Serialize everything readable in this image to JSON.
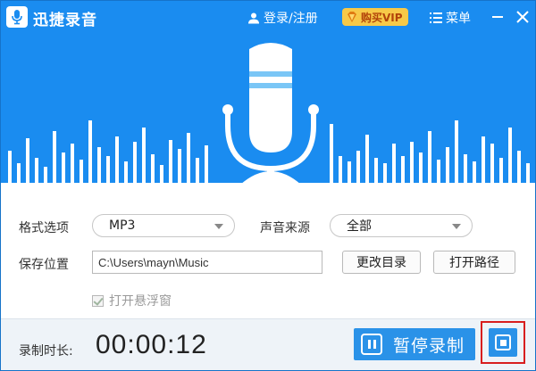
{
  "window": {
    "title": "迅捷录音",
    "login_label": "登录/注册",
    "vip_label": "购买VIP",
    "menu_label": "菜单",
    "icons": {
      "logo": "microphone-logo-icon",
      "user": "user-icon",
      "vip": "vip-gem-icon",
      "menu": "menu-icon",
      "minimize": "minimize-icon",
      "close": "close-icon"
    }
  },
  "settings": {
    "format_label": "格式选项",
    "format_value": "MP3",
    "source_label": "声音来源",
    "source_value": "全部",
    "save_label": "保存位置",
    "save_path": "C:\\Users\\mayn\\Music",
    "change_dir_label": "更改目录",
    "open_path_label": "打开路径",
    "float_window_label": "打开悬浮窗",
    "float_window_checked": true
  },
  "recording": {
    "duration_label": "录制时长:",
    "duration_value": "00:00:12",
    "pause_label": "暂停录制",
    "pause_icon": "pause-icon",
    "stop_icon": "stop-icon"
  },
  "colors": {
    "header_blue": "#1a8cf0",
    "button_blue": "#2a92e8",
    "vip_gold": "#f7c948",
    "highlight_red": "#d81e1e"
  }
}
